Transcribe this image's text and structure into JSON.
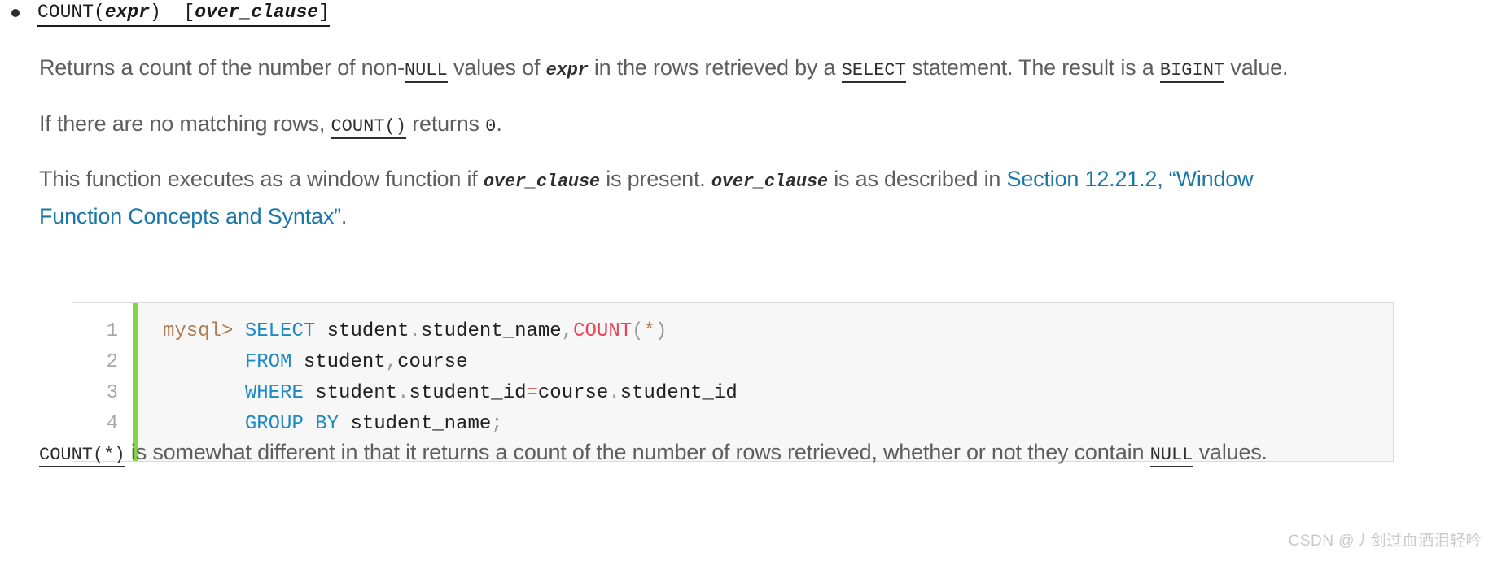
{
  "syntax": {
    "prefix": "COUNT(",
    "arg": "expr",
    "mid": ")  [",
    "over": "over_clause",
    "suffix": "]"
  },
  "paragraphs": {
    "p1": {
      "s1": "Returns a count of the number of non-",
      "c1": "NULL",
      "s2": " values of ",
      "i1": "expr",
      "s3": " in the rows retrieved by a ",
      "c2": "SELECT",
      "s4": " statement. The result is a ",
      "c3": "BIGINT",
      "s5": " value."
    },
    "p2": {
      "s1": "If there are no matching rows, ",
      "c1": "COUNT()",
      "s2": " returns ",
      "c2": "0",
      "s3": "."
    },
    "p3": {
      "s1": "This function executes as a window function if ",
      "i1": "over_clause",
      "s2": " is present. ",
      "i2": "over_clause",
      "s3": " is as described in ",
      "link": "Section 12.21.2, “Window Function Concepts and Syntax”",
      "s4": "."
    },
    "p4": {
      "c1": "COUNT(*)",
      "s1": " is somewhat different in that it returns a count of the number of rows retrieved, whether or not they contain ",
      "c2": "NULL",
      "s2": " values."
    }
  },
  "code_block": {
    "line_numbers": [
      "1",
      "2",
      "3",
      "4"
    ],
    "lines": [
      {
        "tokens": [
          {
            "t": "mysql> ",
            "c": "tok-prompt"
          },
          {
            "t": "SELECT",
            "c": "tok-kw"
          },
          {
            "t": " student",
            "c": "tok-name"
          },
          {
            "t": ".",
            "c": "tok-punct"
          },
          {
            "t": "student_name",
            "c": "tok-name"
          },
          {
            "t": ",",
            "c": "tok-punct"
          },
          {
            "t": "COUNT",
            "c": "tok-fn"
          },
          {
            "t": "(",
            "c": "tok-punct"
          },
          {
            "t": "*",
            "c": "tok-star"
          },
          {
            "t": ")",
            "c": "tok-punct"
          }
        ]
      },
      {
        "tokens": [
          {
            "t": "       ",
            "c": "tok-name"
          },
          {
            "t": "FROM",
            "c": "tok-kw"
          },
          {
            "t": " student",
            "c": "tok-name"
          },
          {
            "t": ",",
            "c": "tok-punct"
          },
          {
            "t": "course",
            "c": "tok-name"
          }
        ]
      },
      {
        "tokens": [
          {
            "t": "       ",
            "c": "tok-name"
          },
          {
            "t": "WHERE",
            "c": "tok-kw"
          },
          {
            "t": " student",
            "c": "tok-name"
          },
          {
            "t": ".",
            "c": "tok-punct"
          },
          {
            "t": "student_id",
            "c": "tok-name"
          },
          {
            "t": "=",
            "c": "tok-op"
          },
          {
            "t": "course",
            "c": "tok-name"
          },
          {
            "t": ".",
            "c": "tok-punct"
          },
          {
            "t": "student_id",
            "c": "tok-name"
          }
        ]
      },
      {
        "tokens": [
          {
            "t": "       ",
            "c": "tok-name"
          },
          {
            "t": "GROUP BY",
            "c": "tok-kw"
          },
          {
            "t": " student_name",
            "c": "tok-name"
          },
          {
            "t": ";",
            "c": "tok-semi"
          }
        ]
      }
    ]
  },
  "watermark": "CSDN @丿剑过血洒泪轻吟",
  "colors": {
    "link": "#1a77a8",
    "green_bar": "#81d742",
    "keyword": "#1f8ac0",
    "function": "#e8435a",
    "prompt": "#b07b50"
  }
}
